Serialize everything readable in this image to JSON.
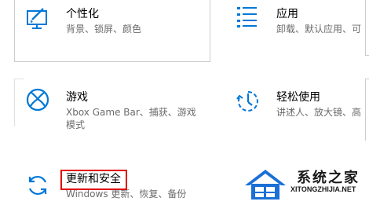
{
  "tiles": {
    "personalization": {
      "title": "个性化",
      "desc": "背景、锁屏、颜色"
    },
    "apps": {
      "title": "应用",
      "desc": "卸载、默认应用、可"
    },
    "gaming": {
      "title": "游戏",
      "desc_line1": "Xbox Game Bar、捕获、游戏",
      "desc_line2": "模式"
    },
    "ease_of_access": {
      "title": "轻松使用",
      "desc": "讲述人、放大镜、高"
    },
    "update_security": {
      "title": "更新和安全",
      "desc": "Windows 更新、恢复、备份"
    }
  },
  "watermark": {
    "name": "系统之家",
    "url": "XITONGZHIJIA.NET"
  },
  "colors": {
    "accent": "#0078d7",
    "highlight": "#e00000",
    "desc_text": "#6b6b6b"
  },
  "icons": {
    "personalization": "paint-monitor-icon",
    "apps": "apps-list-icon",
    "gaming": "xbox-icon",
    "ease_of_access": "ease-of-access-icon",
    "update_security": "sync-arrows-icon"
  }
}
